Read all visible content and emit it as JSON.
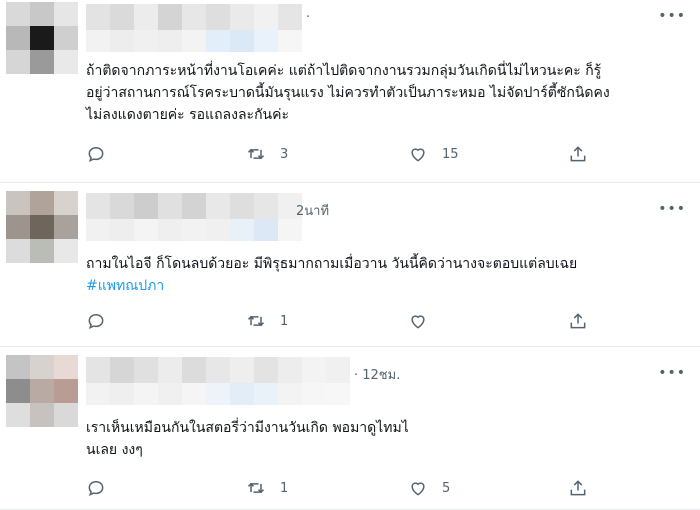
{
  "tweets": [
    {
      "time": ".",
      "text_lines": [
        "ถ้าติดจากภาระหน้าที่งานโอเคค่ะ แต่ถ้าไปติดจากงานรวมกลุ่มวันเกิดนี่ไม่ไหวนะคะ ก็รู้",
        "อยู่ว่าสถานการณ์โรคระบาดนี้มันรุนแรง ไม่ควรทำตัวเป็นภาระหมอ ไม่จัดปาร์ตี้ซักนิดคง",
        "ไม่ลงแดงตายค่ะ  รอแถลงละกันค่ะ"
      ],
      "replies": "",
      "retweets": "3",
      "likes": "15"
    },
    {
      "time": "2นาที",
      "text_lines": [
        "ถามในไอจี ก็โดนลบด้วยอะ มีพิรุธมากถามเมื่อวาน วันนี้คิดว่านางจะตอบแต่ลบเฉย"
      ],
      "hashtag": "#แพทณปภา",
      "replies": "",
      "retweets": "1",
      "likes": ""
    },
    {
      "time": "· 12ชม.",
      "text_lines": [
        "เราเห็นเหมือนกันในสตอรี่ว่ามีงานวันเกิด พอมาดูไทมไ",
        "นเลย งงๆ"
      ],
      "replies": "",
      "retweets": "1",
      "likes": "5"
    }
  ],
  "icons": {
    "reply": "reply-icon",
    "retweet": "retweet-icon",
    "like": "heart-icon",
    "share": "share-icon",
    "more": "more-icon"
  },
  "colors": {
    "text": "#0f1419",
    "muted": "#536471",
    "hashtag": "#1d9bf0",
    "divider": "#e6ecf0"
  }
}
